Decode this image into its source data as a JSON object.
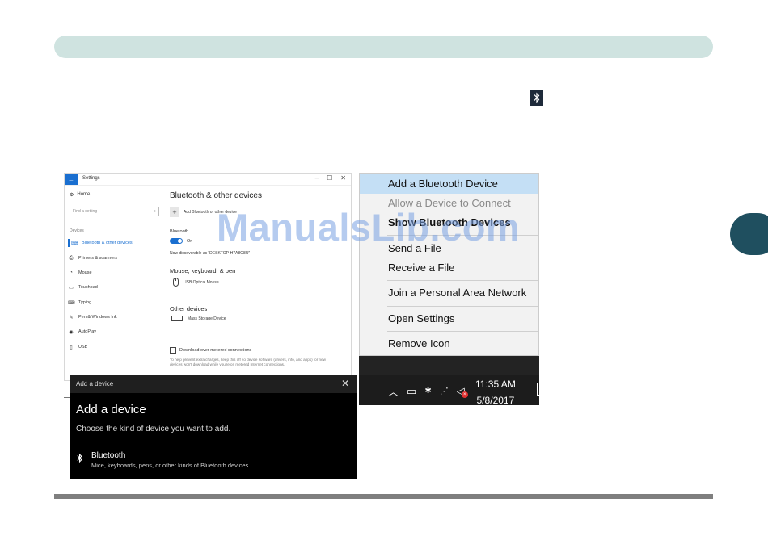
{
  "settings": {
    "title": "Settings",
    "back_glyph": "←",
    "controls": [
      "–",
      "☐",
      "✕"
    ],
    "home": "Home",
    "find_placeholder": "Find a setting",
    "section": "Devices",
    "nav_items": [
      {
        "label": "Bluetooth & other devices",
        "icon": "⌨",
        "active": true
      },
      {
        "label": "Printers & scanners",
        "icon": "⎙",
        "active": false
      },
      {
        "label": "Mouse",
        "icon": "◔",
        "active": false
      },
      {
        "label": "Touchpad",
        "icon": "▭",
        "active": false
      },
      {
        "label": "Typing",
        "icon": "⌨",
        "active": false
      },
      {
        "label": "Pen & Windows Ink",
        "icon": "✎",
        "active": false
      },
      {
        "label": "AutoPlay",
        "icon": "◉",
        "active": false
      },
      {
        "label": "USB",
        "icon": "▯",
        "active": false
      }
    ],
    "content": {
      "title": "Bluetooth & other devices",
      "add_label": "Add Bluetooth or other device",
      "bluetooth_label": "Bluetooth",
      "toggle_state": "On",
      "discoverable": "Now discoverable as “DESKTOP-H7A8O8U”",
      "mouse_section": "Mouse, keyboard, & pen",
      "mouse_device": "USB Optical Mouse",
      "other_section": "Other devices",
      "other_device": "Mass Storage Device",
      "metered_label": "Download over metered connections",
      "metered_desc": "To help prevent extra charges, keep this off so device software (drivers, info, and apps) for new devices won't download while you're on metered Internet connections."
    }
  },
  "context_menu": {
    "items": [
      {
        "label": "Add a Bluetooth Device",
        "state": "highlighted"
      },
      {
        "label": "Allow a Device to Connect",
        "state": "disabled"
      },
      {
        "label": "Show Bluetooth Devices",
        "state": "bold"
      },
      {
        "label": "Send a File",
        "state": "normal"
      },
      {
        "label": "Receive a File",
        "state": "normal"
      },
      {
        "label": "Join a Personal Area Network",
        "state": "normal"
      },
      {
        "label": "Open Settings",
        "state": "normal"
      },
      {
        "label": "Remove Icon",
        "state": "normal"
      }
    ]
  },
  "taskbar": {
    "time": "11:35 AM",
    "date": "5/8/2017",
    "icons": [
      "chevron-up-icon",
      "battery-icon",
      "bluetooth-icon",
      "wifi-icon",
      "volume-muted-icon"
    ]
  },
  "add_device": {
    "title": "Add a device",
    "heading": "Add a device",
    "subtitle": "Choose the kind of device you want to add.",
    "option_name": "Bluetooth",
    "option_desc": "Mice, keyboards, pens, or other kinds of Bluetooth devices"
  },
  "watermark": "ManualsLib.com",
  "colors": {
    "header_bar": "#cfe3e0",
    "side_tab": "#1f4f5f",
    "accent": "#1a6fd0",
    "menu_highlight": "#c4dff5"
  }
}
